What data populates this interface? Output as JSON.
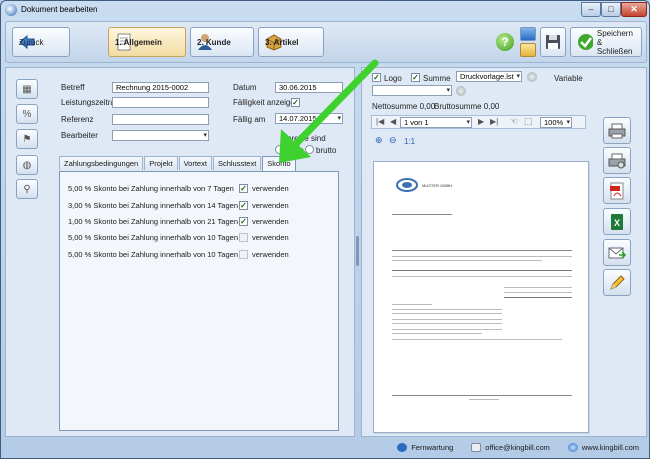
{
  "window": {
    "title": "Dokument bearbeiten"
  },
  "toolbar": {
    "back_label": "Zurück",
    "tabs": [
      {
        "label": "1. Allgemein"
      },
      {
        "label": "2. Kunde"
      },
      {
        "label": "3. Artikel"
      }
    ],
    "save_close_label_1": "Speichern",
    "save_close_label_2": "& Schließen"
  },
  "form": {
    "betreff_label": "Betreff",
    "betreff_value": "Rechnung 2015-0002",
    "leistungszeitraum_label": "Leistungszeitraum",
    "referenz_label": "Referenz",
    "bearbeiter_label": "Bearbeiter",
    "datum_label": "Datum",
    "datum_value": "30.06.2015",
    "faelligkeit_label": "Fälligkeit anzeigen",
    "faellig_am_label": "Fällig am",
    "faellig_am_value": "14.07.2015",
    "preise_sind_label": "preise sind",
    "netto_label": "netto",
    "brutto_label": "brutto"
  },
  "tabs": [
    {
      "label": "Zahlungsbedingungen"
    },
    {
      "label": "Projekt"
    },
    {
      "label": "Vortext"
    },
    {
      "label": "Schlusstext"
    },
    {
      "label": "Skonto"
    }
  ],
  "skonto": {
    "rows": [
      {
        "text": "5,00 % Skonto bei Zahlung innerhalb von  7  Tagen",
        "checked": true,
        "label": "verwenden"
      },
      {
        "text": "3,00 % Skonto bei Zahlung innerhalb von 14  Tagen",
        "checked": true,
        "label": "verwenden"
      },
      {
        "text": "1,00 % Skonto bei Zahlung innerhalb von 21  Tagen",
        "checked": true,
        "label": "verwenden"
      },
      {
        "text": "5,00 % Skonto bei Zahlung innerhalb von 10  Tagen",
        "checked": false,
        "label": "verwenden"
      },
      {
        "text": "5,00 % Skonto bei Zahlung innerhalb von 10  Tagen",
        "checked": false,
        "label": "verwenden"
      }
    ]
  },
  "preview": {
    "logo_label": "Logo",
    "summe_label": "Summe",
    "template_value": "Druckvorlage.lst",
    "variable_label": "Variable",
    "nettosumme_label": "Nettosumme 0,00",
    "bruttosumme_label": "Bruttosumme 0,00",
    "page_value": "1 von 1",
    "zoom_value": "100%",
    "zoom_ratio": "1:1",
    "company_name": "MUSTER GMBH"
  },
  "status": {
    "fernwartung": "Fernwartung",
    "email": "office@kingbill.com",
    "web": "www.kingbill.com"
  },
  "colors": {
    "accent_green": "#3fd12f"
  }
}
